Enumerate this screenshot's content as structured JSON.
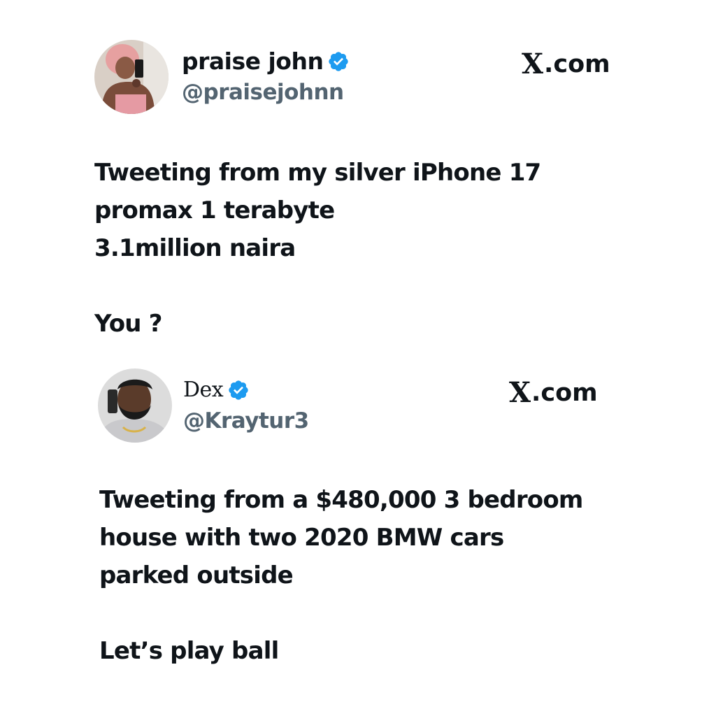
{
  "tweets": [
    {
      "display_name": "praise john",
      "handle": "@praisejohnn",
      "brand": "X.com",
      "brand_glyph": "X",
      "brand_suffix": ".com",
      "verified": true,
      "text_lines": [
        "Tweeting from my silver iPhone 17",
        "promax 1 terabyte",
        "3.1million naira",
        "",
        "You ?"
      ]
    },
    {
      "display_name": "Dex",
      "handle": "@Kraytur3",
      "brand": "X.com",
      "brand_glyph": "X",
      "brand_suffix": ".com",
      "verified": true,
      "text_lines": [
        "Tweeting from a $480,000 3 bedroom",
        "house with two 2020 BMW cars",
        "parked outside",
        "",
        "Let’s play ball"
      ]
    }
  ],
  "colors": {
    "verified_blue": "#1d9bf0",
    "handle_gray": "#536471",
    "text": "#0f1419",
    "background": "#ffffff"
  },
  "icons": {
    "verified": "verified-badge-icon",
    "avatar_1": "profile-photo",
    "avatar_2": "profile-photo"
  }
}
